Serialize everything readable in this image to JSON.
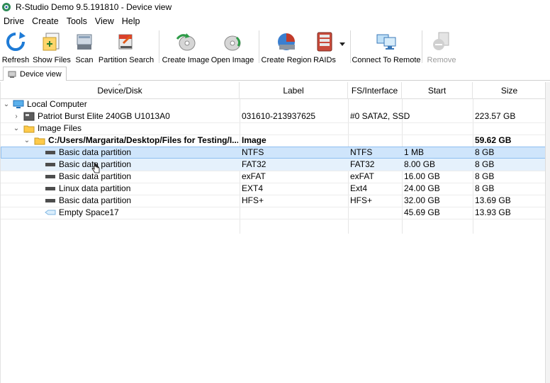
{
  "window": {
    "title": "R-Studio Demo 9.5.191810 - Device view",
    "icon": "r-studio-app-icon"
  },
  "menu": [
    "Drive",
    "Create",
    "Tools",
    "View",
    "Help"
  ],
  "toolbar": {
    "refresh": "Refresh",
    "show_files": "Show Files",
    "scan": "Scan",
    "partition_search": "Partition Search",
    "create_image": "Create Image",
    "open_image": "Open Image",
    "create_region": "Create Region",
    "raids": "RAIDs",
    "connect_remote": "Connect To Remote",
    "remove": "Remove"
  },
  "tab": {
    "label": "Device view"
  },
  "columns": {
    "device": "Device/Disk",
    "label": "Label",
    "fs": "FS/Interface",
    "start": "Start",
    "size": "Size"
  },
  "rows": [
    {
      "name": "Local Computer",
      "label": "",
      "fs": "",
      "start": "",
      "size": ""
    },
    {
      "name": "Patriot Burst Elite 240GB U1013A0",
      "label": "031610-213937625",
      "fs": "#0 SATA2, SSD",
      "start": "",
      "size": "223.57 GB"
    },
    {
      "name": "Image Files",
      "label": "",
      "fs": "",
      "start": "",
      "size": ""
    },
    {
      "name": "C:/Users/Margarita/Desktop/Files for Testing/I...",
      "label": "Image",
      "fs": "",
      "start": "",
      "size": "59.62 GB"
    },
    {
      "name": "Basic data partition",
      "label": "NTFS",
      "fs": "NTFS",
      "start": "1 MB",
      "size": "8 GB"
    },
    {
      "name": "Basic data partition",
      "label": "FAT32",
      "fs": "FAT32",
      "start": "8.00 GB",
      "size": "8 GB"
    },
    {
      "name": "Basic data partition",
      "label": "exFAT",
      "fs": "exFAT",
      "start": "16.00 GB",
      "size": "8 GB"
    },
    {
      "name": "Linux data partition",
      "label": "EXT4",
      "fs": "Ext4",
      "start": "24.00 GB",
      "size": "8 GB"
    },
    {
      "name": "Basic data partition",
      "label": "HFS+",
      "fs": "HFS+",
      "start": "32.00 GB",
      "size": "13.69 GB"
    },
    {
      "name": "Empty Space17",
      "label": "",
      "fs": "",
      "start": "45.69 GB",
      "size": "13.93 GB"
    }
  ],
  "colors": {
    "selection": "#cfe5fb",
    "selection_border": "#8ebff1",
    "hover": "#e5f1fc"
  }
}
